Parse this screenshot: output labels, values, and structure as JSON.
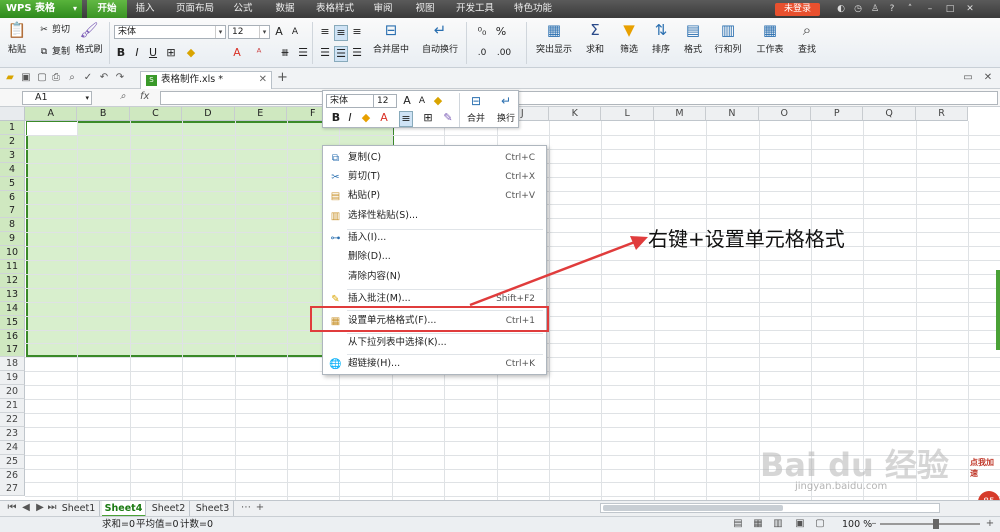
{
  "titlebar": {
    "app_button": "WPS 表格",
    "tabs": [
      "开始",
      "插入",
      "页面布局",
      "公式",
      "数据",
      "表格样式",
      "审阅",
      "视图",
      "开发工具",
      "特色功能"
    ],
    "login": "未登录"
  },
  "ribbon": {
    "paste": "粘贴",
    "cut": "剪切",
    "copy": "复制",
    "format_painter": "格式刷",
    "font_name": "宋体",
    "font_size": "12",
    "merge_center": "合并居中",
    "wrap_text": "自动换行",
    "percent": "%",
    "highlight": "突出显示",
    "sum": "求和",
    "filter": "筛选",
    "sort": "排序",
    "format": "格式",
    "rows_cols": "行和列",
    "worksheet": "工作表",
    "find": "查找",
    "bold": "B",
    "italic": "I",
    "underline": "U"
  },
  "doc_tab": {
    "name": "表格制作.xls *",
    "icon": "S"
  },
  "formula_bar": {
    "cell_ref": "A1",
    "fx": "fx"
  },
  "grid": {
    "columns": [
      "A",
      "B",
      "C",
      "D",
      "E",
      "F",
      "G",
      "H",
      "I",
      "J",
      "K",
      "L",
      "M",
      "N",
      "O",
      "P",
      "Q",
      "R"
    ],
    "rows": [
      "1",
      "2",
      "3",
      "4",
      "5",
      "6",
      "7",
      "8",
      "9",
      "10",
      "11",
      "12",
      "13",
      "14",
      "15",
      "16",
      "17",
      "18",
      "19",
      "20",
      "21",
      "22",
      "23",
      "24",
      "25",
      "26",
      "27"
    ]
  },
  "mini_toolbar": {
    "font_name": "宋体",
    "font_size": "12",
    "merge": "合并",
    "wrap": "换行",
    "bold": "B",
    "italic": "I"
  },
  "context_menu": {
    "items": [
      {
        "label": "复制(C)",
        "shortcut": "Ctrl+C",
        "icon": "copy-icon"
      },
      {
        "label": "剪切(T)",
        "shortcut": "Ctrl+X",
        "icon": "scissors-icon"
      },
      {
        "label": "粘贴(P)",
        "shortcut": "Ctrl+V",
        "icon": "paste-icon"
      },
      {
        "label": "选择性粘贴(S)...",
        "shortcut": "",
        "icon": "paste-special-icon"
      },
      {
        "label": "插入(I)...",
        "shortcut": "",
        "icon": "insert-icon"
      },
      {
        "label": "删除(D)...",
        "shortcut": "",
        "icon": ""
      },
      {
        "label": "清除内容(N)",
        "shortcut": "",
        "icon": ""
      },
      {
        "label": "插入批注(M)...",
        "shortcut": "Shift+F2",
        "icon": "comment-icon"
      },
      {
        "label": "设置单元格格式(F)...",
        "shortcut": "Ctrl+1",
        "icon": "format-cells-icon"
      },
      {
        "label": "从下拉列表中选择(K)...",
        "shortcut": "",
        "icon": ""
      },
      {
        "label": "超链接(H)...",
        "shortcut": "Ctrl+K",
        "icon": "hyperlink-icon"
      }
    ]
  },
  "annotation": {
    "text": "右键+设置单元格格式",
    "color": "#e03c3c"
  },
  "sheets": {
    "tabs": [
      "Sheet1",
      "Sheet4",
      "Sheet2",
      "Sheet3"
    ],
    "active": "Sheet4"
  },
  "status": {
    "sum": "求和=0",
    "avg": "平均值=0",
    "count": "计数=0",
    "zoom": "100 %"
  },
  "watermark": {
    "text": "Bai du 经验",
    "sub": "jingyan.baidu.com",
    "badge": "点我加速",
    "badge_num": "85"
  },
  "colors": {
    "accent_green": "#4aa136",
    "selection_fill": "#d8efcd",
    "highlight_red": "#e03c3c"
  }
}
